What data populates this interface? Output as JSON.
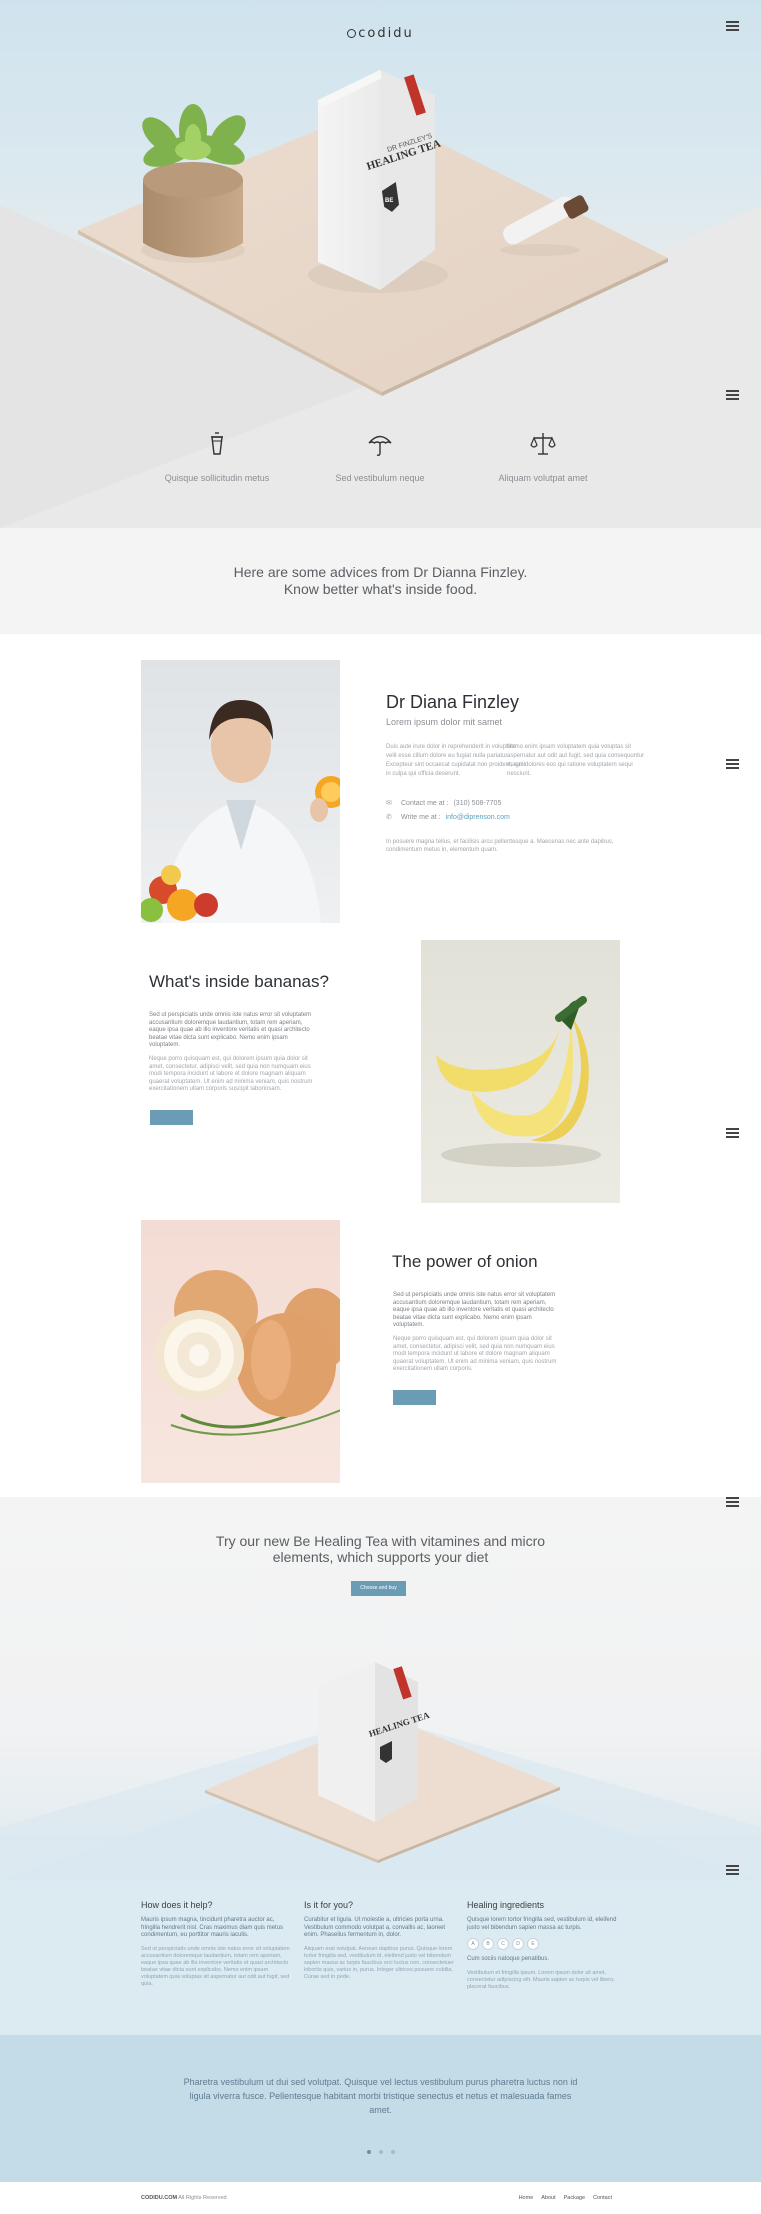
{
  "header": {
    "logo_text": "codidu"
  },
  "hero": {
    "package": {
      "brand_top": "DR FINZLEY'S",
      "brand_name": "HEALING TEA",
      "badge": "BE"
    }
  },
  "features": [
    {
      "label": "Quisque sollicitudin metus",
      "icon": "cup-icon"
    },
    {
      "label": "Sed vestibulum neque",
      "icon": "umbrella-icon"
    },
    {
      "label": "Aliquam volutpat amet",
      "icon": "scales-icon"
    }
  ],
  "advice": {
    "line1": "Here are some advices from Dr Dianna Finzley.",
    "line2": "Know better what's inside food."
  },
  "doctor": {
    "name": "Dr Diana Finzley",
    "subtitle": "Lorem ipsum dolor mit samet",
    "col1": "Duis aute irure dolor in reprehenderit in voluptate velit esse cillum dolore eu fugiat nulla pariatur. Excepteur sint occaecat cupidatat non proident, sunt in culpa qui officia deserunt.",
    "col2": "Nemo enim ipsam voluptatem quia voluptas sit aspernatur aut odit aut fugit, sed quia consequuntur magni dolores eos qui ratione voluptatem sequi nesciunt.",
    "contact_label": "Contact me at :",
    "phone": "(310) 508-7705",
    "write_label": "Write me at :",
    "email": "info@diprenson.com",
    "note": "In posuere magna tellus, et facilisis arcu pellentesque a. Maecenas nec ante dapibus, condimentum metus in, elementum quam."
  },
  "bananas": {
    "title": "What's inside bananas?",
    "text1": "Sed ut perspiciatis unde omnis iste natus error sit voluptatem accusantium doloremque laudantium, totam rem aperiam, eaque ipsa quae ab illo inventore veritatis et quasi architecto beatae vitae dicta sunt explicabo. Nemo enim ipsam voluptatem.",
    "text2": "Neque porro quisquam est, qui dolorem ipsum quia dolor sit amet, consectetur, adipisci velit, sed quia non numquam eius modi tempora incidunt ut labore et dolore magnam aliquam quaerat voluptatem. Ut enim ad minima veniam, quis nostrum exercitationem ullam corporis suscipit laboriosam."
  },
  "onion": {
    "title": "The power of onion",
    "text1": "Sed ut perspiciatis unde omnis iste natus error sit voluptatem accusantium doloremque laudantium, totam rem aperiam, eaque ipsa quae ab illo inventore veritatis et quasi architecto beatae vitae dicta sunt explicabo. Nemo enim ipsam voluptatem.",
    "text2": "Neque porro quisquam est, qui dolorem ipsum quia dolor sit amet, consectetur, adipisci velit, sed quia non numquam eius modi tempora incidunt ut labore et dolore magnam aliquam quaerat voluptatem. Ut enim ad minima veniam, quis nostrum exercitationem ullam corporis."
  },
  "promo": {
    "line1": "Try our new Be Healing Tea with vitamines and micro",
    "line2": "elements, which supports your diet",
    "button": "Choose and buy"
  },
  "info": [
    {
      "title": "How does it help?",
      "lead": "Mauris ipsum magna, tincidunt pharetra auctor ac, fringilla hendrerit nisl. Cras maximus diam quis metus condimentum, eu porttitor mauris iaculis.",
      "body": "Sed ut perspiciatis unde omnis iste natus error sit voluptatem accusantium doloremque laudantium, totam rem aperiam, eaque ipsa quae ab illo inventore veritatis et quasi architecto beatae vitae dicta sunt explicabo. Nemo enim ipsam voluptatem quia voluptas sit aspernatur aut odit aut fugit, sed quia."
    },
    {
      "title": "Is it for you?",
      "lead": "Curabitur et ligula. Ut molestie a, ultricies porta urna. Vestibulum commodo volutpat a, convallis ac, laoreet enim. Phasellus fermentum in, dolor.",
      "body": "Aliquam erat volutpat. Aenean dapibus purus. Quisque lorem tortor fringilla sed, vestibulum id, eleifend justo vel bibendum sapien massa ac turpis faucibus orci luctus non, consectetuer lobortis quis, varius in, purus. Integer ultrices posuere cubilia. Curae sed in pede."
    },
    {
      "title": "Healing ingredients",
      "lead": "Quisque lorem tortor fringilla sed, vestibulum id, eleifend justo vel bibendum sapien massa ac turpis.",
      "letters": [
        "A",
        "B",
        "C",
        "D",
        "E"
      ],
      "lead2": "Cum sociis natoque penatibus.",
      "body": "Vestibulum et fringilla ipsum. Lorem ipsum dolor sit amet, consectetur adipiscing elit. Mauris sapien ac turpis vel libero, placerat faucibus."
    }
  ],
  "quote": {
    "text": "Pharetra vestibulum ut dui sed volutpat. Quisque vel lectus vestibulum purus pharetra luctus non id ligula viverra fusce. Pellentesque habitant morbi tristique senectus et netus et malesuada fames amet.",
    "active_slide": 1,
    "slides": 3
  },
  "footer": {
    "brand": "CODIDU.COM",
    "rights": "All Rights Reserved",
    "nav": [
      "Home",
      "About",
      "Package",
      "Contact"
    ]
  }
}
